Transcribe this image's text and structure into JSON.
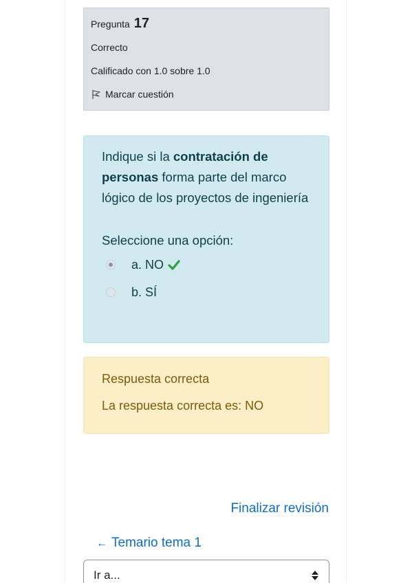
{
  "info": {
    "question_prefix": "Pregunta",
    "question_number": "17",
    "state": "Correcto",
    "grade": "Calificado con 1.0 sobre 1.0",
    "flag_label": "Marcar cuestión",
    "flag_icon": "flag-icon"
  },
  "question": {
    "text_before": "Indique si la ",
    "text_bold": "contratación de personas",
    "text_after": " forma parte del marco lógico de los proyectos de ingeniería",
    "prompt": "Seleccione una opción:",
    "options": [
      {
        "label": "a. NO",
        "selected": true,
        "correct": true,
        "icon": "check-icon"
      },
      {
        "label": "b. SÍ",
        "selected": false,
        "correct": false
      }
    ]
  },
  "feedback": {
    "result": "Respuesta correcta",
    "correct_answer": "La respuesta correcta es: NO"
  },
  "navigation": {
    "finish_label": "Finalizar revisión",
    "prev_arrow": "←",
    "prev_label": "Temario tema 1",
    "jump_placeholder": "Ir a...",
    "jump_icon": "sort-arrows-icon"
  },
  "colors": {
    "info_bg": "#dee2e6",
    "question_bg": "#d1eaf0",
    "question_text": "#103f4c",
    "feedback_bg": "#fcefc7",
    "feedback_text": "#7d5a0b",
    "link": "#0f6cbf",
    "check": "#2e9e45"
  }
}
